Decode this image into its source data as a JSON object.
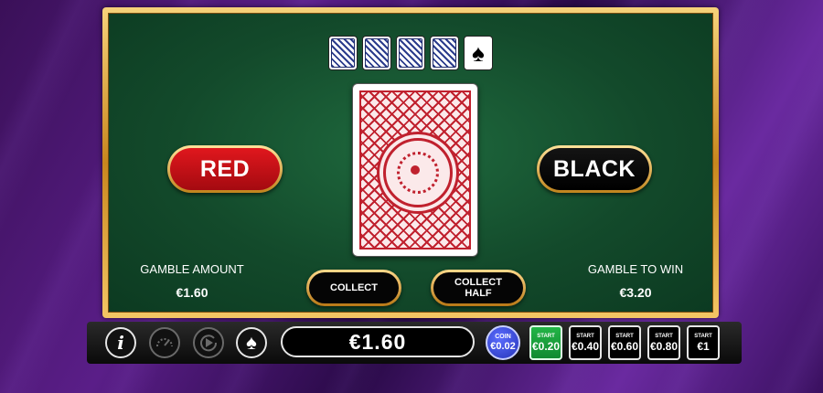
{
  "history": {
    "cards": [
      {
        "type": "back",
        "icon": "card-back-icon"
      },
      {
        "type": "back",
        "icon": "card-back-icon"
      },
      {
        "type": "back",
        "icon": "card-back-icon"
      },
      {
        "type": "back",
        "icon": "card-back-icon"
      },
      {
        "type": "suit",
        "symbol": "♠",
        "icon": "spade-icon"
      }
    ]
  },
  "choices": {
    "red_label": "RED",
    "black_label": "BLACK"
  },
  "gamble_amount": {
    "label": "GAMBLE AMOUNT",
    "value": "€1.60"
  },
  "gamble_to_win": {
    "label": "GAMBLE TO WIN",
    "value": "€3.20"
  },
  "buttons": {
    "collect": "COLLECT",
    "collect_half": "COLLECT\nHALF"
  },
  "bottom_bar": {
    "balance": "€1.60",
    "info_symbol": "i",
    "spade_symbol": "♠",
    "coin": {
      "label": "COIN",
      "value": "€0.02"
    },
    "stakes": [
      {
        "label": "START",
        "value": "€0.20",
        "active": true
      },
      {
        "label": "START",
        "value": "€0.40",
        "active": false
      },
      {
        "label": "START",
        "value": "€0.60",
        "active": false
      },
      {
        "label": "START",
        "value": "€0.80",
        "active": false
      },
      {
        "label": "START",
        "value": "€1",
        "active": false
      }
    ]
  },
  "colors": {
    "felt": "#134a2b",
    "gold": "#e0a83a",
    "red_button": "#e0171d",
    "stake_active": "#23b547",
    "coin": "#2f3fd0"
  }
}
